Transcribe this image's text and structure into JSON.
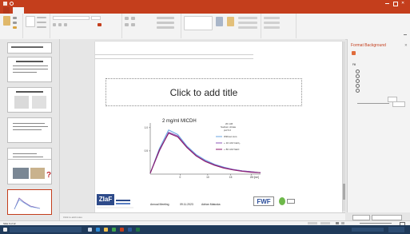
{
  "slide": {
    "title_placeholder": "Click to add title",
    "chart_title": "2 mg/ml MICDH",
    "legend_header_1": "20 mM",
    "legend_header_2": "Sodium citrate",
    "legend_header_3": "pH 5.0",
    "legend_items": [
      {
        "label": "Without ions",
        "color": "#6aa6e0"
      },
      {
        "label": "+ 10 mM CaCl₂",
        "color": "#8e59b8"
      },
      {
        "label": "+ 80 mM NaCl",
        "color": "#8b1a6b"
      }
    ],
    "footer": {
      "meeting": "Annual Meeting",
      "date": "09.11.2023",
      "author": "Adrian Matuska"
    }
  },
  "chart_data": {
    "type": "line",
    "x": [
      0,
      2,
      4,
      6,
      8,
      10,
      12,
      14,
      16,
      18,
      20,
      22,
      24
    ],
    "series": [
      {
        "name": "Without ions",
        "values": [
          0.02,
          0.55,
          0.95,
          0.85,
          0.6,
          0.42,
          0.3,
          0.21,
          0.15,
          0.1,
          0.07,
          0.05,
          0.03
        ]
      },
      {
        "name": "+ 10 mM CaCl₂",
        "values": [
          0.02,
          0.5,
          0.9,
          0.82,
          0.58,
          0.4,
          0.28,
          0.2,
          0.14,
          0.1,
          0.07,
          0.05,
          0.03
        ]
      },
      {
        "name": "+ 80 mM NaCl",
        "values": [
          0.02,
          0.52,
          0.88,
          0.8,
          0.57,
          0.39,
          0.27,
          0.19,
          0.13,
          0.09,
          0.06,
          0.04,
          0.03
        ]
      }
    ],
    "x_ticks": [
      "0",
      "10",
      "15",
      "20"
    ],
    "y_ticks": [
      "0.5",
      "1.0"
    ],
    "xlabel": "t [nm]",
    "ylim": [
      0,
      1.1
    ],
    "xlim": [
      0,
      24
    ]
  },
  "pane": {
    "title": "Format Background",
    "section": "Fill"
  },
  "status": {
    "slide_info": "Slide 9 of 12"
  },
  "notes": {
    "placeholder": "Click to add notes"
  },
  "colors": {
    "accent": "#c43e1c"
  }
}
